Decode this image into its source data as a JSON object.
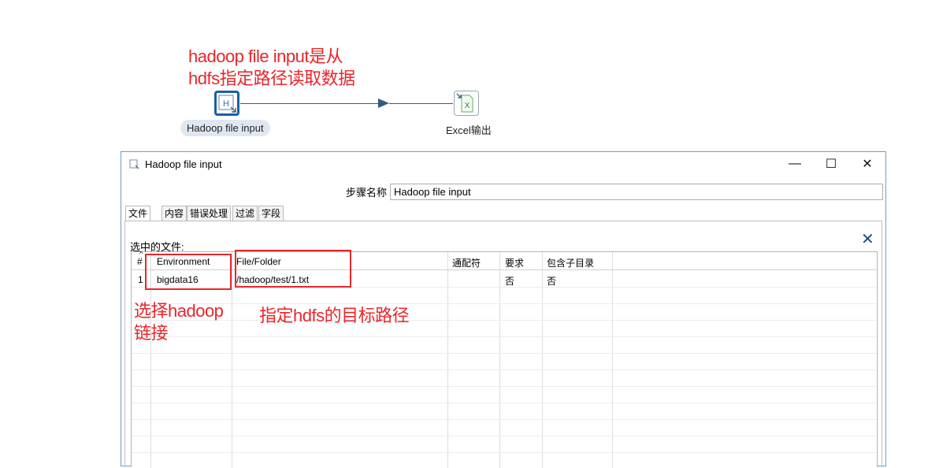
{
  "annotations": {
    "top_line1": "hadoop file input是从",
    "top_line2": "hdfs指定路径读取数据",
    "env_line1": "选择hadoop",
    "env_line2": "链接",
    "path_note": "指定hdfs的目标路径"
  },
  "canvas": {
    "step_hadoop": {
      "label": "Hadoop file input",
      "icon_glyph": "H",
      "icon": "hadoop-file-input-icon"
    },
    "step_excel": {
      "label": "Excel输出",
      "icon_glyph": "X",
      "icon": "excel-output-icon"
    }
  },
  "dialog": {
    "title": "Hadoop file input",
    "window_buttons": {
      "minimize": "—",
      "maximize": "☐",
      "close": "✕"
    },
    "step_name_label": "步骤名称",
    "step_name_value": "Hadoop file input",
    "tabs": [
      "文件",
      "内容",
      "错误处理",
      "过滤",
      "字段"
    ],
    "selected_files_label": "选中的文件:",
    "delete_icon": "✕",
    "table": {
      "sort_indicator": "^",
      "columns": [
        "#",
        "Environment",
        "File/Folder",
        "通配符",
        "要求",
        "包含子目录"
      ],
      "rows": [
        [
          "1",
          "bigdata16",
          "/hadoop/test/1.txt",
          "",
          "否",
          "否"
        ]
      ]
    }
  },
  "colors": {
    "annotation_red": "#e8262c",
    "accent_blue": "#1a5fa6",
    "hop_line": "#315a85"
  }
}
